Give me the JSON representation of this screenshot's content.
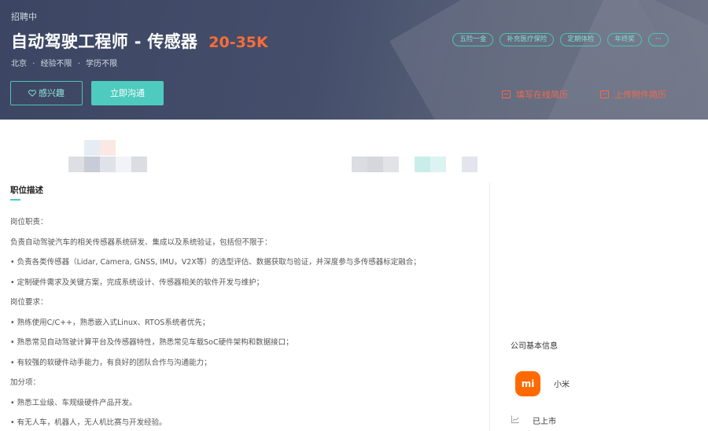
{
  "header": {
    "status": "招聘中",
    "job_title": "自动驾驶工程师 - 传感器",
    "salary": "20-35K",
    "location": "北京",
    "experience": "经验不限",
    "education": "学历不限",
    "separator": "·",
    "tags": [
      "五险一金",
      "补充医疗保险",
      "定期体检",
      "年终奖",
      "···"
    ],
    "like_label": "感兴趣",
    "like_icon": "heart-outline-icon",
    "chat_label": "立即沟通",
    "fill_resume_label": "填写在线简历",
    "upload_resume_label": "上传附件简历",
    "colors": {
      "accent": "#4ecbbe",
      "salary": "#fc6c38",
      "action": "#f26a4e",
      "header_bg": "#3c4663"
    }
  },
  "description": {
    "section_title": "职位描述",
    "lines": [
      "岗位职责：",
      "负责自动驾驶汽车的相关传感器系统研发、集成以及系统验证，包括但不限于：",
      "• 负责各类传感器（Lidar, Camera, GNSS, IMU，V2X等）的选型评估、数据获取与验证，并深度参与多传感器标定融合；",
      "• 定制硬件需求及关键方案，完成系统设计、传感器相关的软件开发与维护；",
      "岗位要求：",
      "• 熟练使用C/C++，熟悉嵌入式Linux、RTOS系统者优先；",
      "• 熟悉常见自动驾驶计算平台及传感器特性，熟悉常见车载SoC硬件架构和数据接口；",
      "• 有较强的软硬件动手能力，有良好的团队合作与沟通能力；",
      "加分项：",
      "• 熟悉工业级、车规级硬件产品开发。",
      "• 有无人车，机器人，无人机比赛与开发经验。"
    ]
  },
  "company": {
    "section_title": "公司基本信息",
    "logo_text": "mi",
    "logo_color": "#ff6a00",
    "name": "小米",
    "listing_status": "已上市",
    "listing_icon": "chart-line-icon"
  }
}
